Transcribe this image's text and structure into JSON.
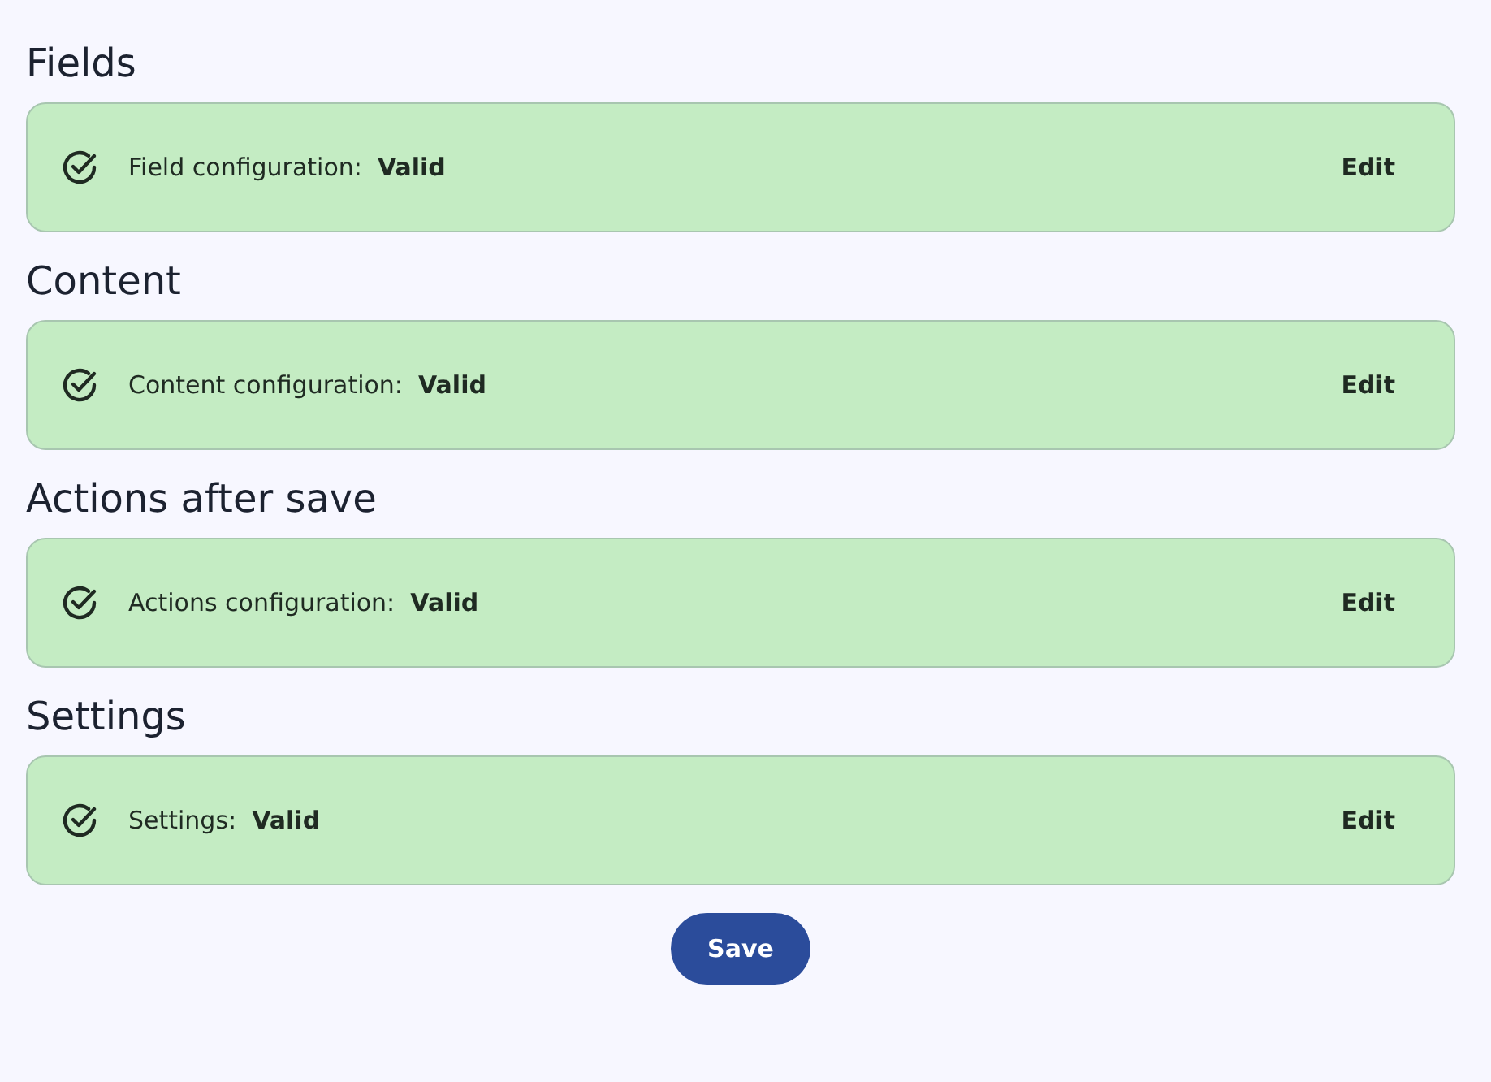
{
  "sections": [
    {
      "title": "Fields",
      "status": "Field configuration:  **Valid**",
      "valid": true,
      "action": "Edit"
    },
    {
      "title": "Content",
      "status": "Content configuration:  **Valid**",
      "valid": true,
      "action": "Edit"
    },
    {
      "title": "Actions after save",
      "status": "Actions configuration:  **Valid**",
      "valid": true,
      "action": "Edit"
    },
    {
      "title": "Settings",
      "status": "Settings:  **Valid**",
      "valid": true,
      "action": "Edit"
    }
  ],
  "save_button": "Save"
}
